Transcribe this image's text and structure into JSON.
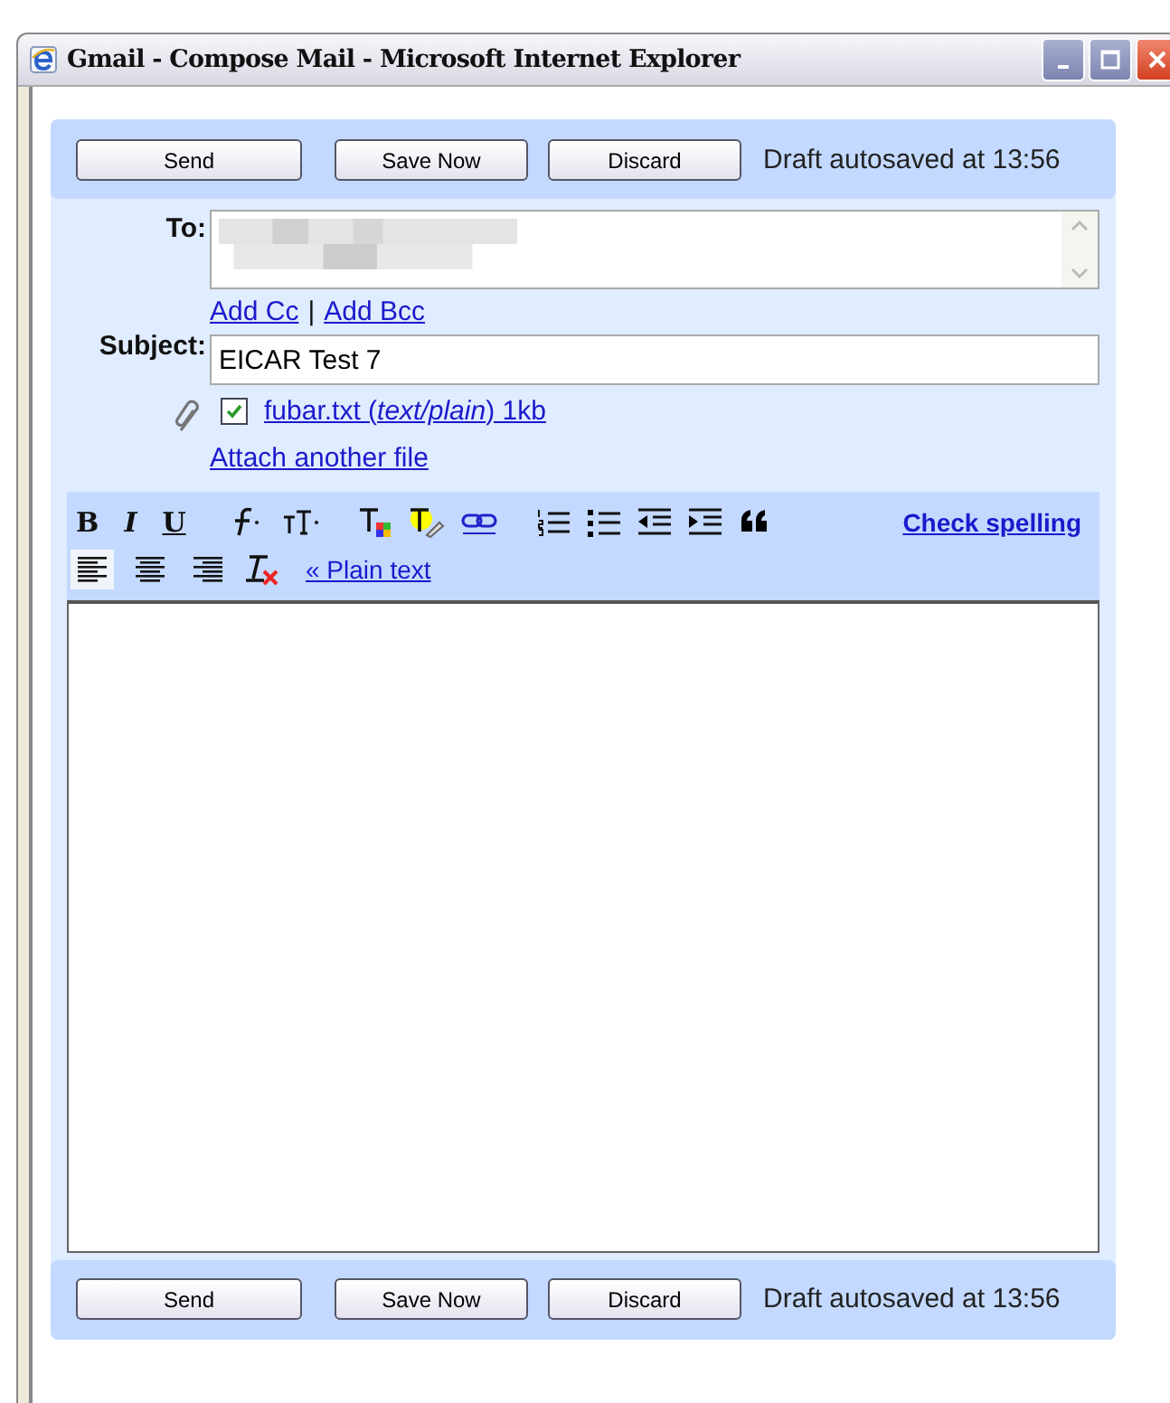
{
  "window": {
    "title": "Gmail - Compose Mail - Microsoft Internet Explorer"
  },
  "top_actions": {
    "buttons": [
      "Send",
      "Save Now",
      "Discard"
    ],
    "status": "Draft autosaved at 13:56"
  },
  "to": {
    "label": "To:"
  },
  "cc_links": [
    "Add Cc",
    "Add Bcc"
  ],
  "cc_separator": "|",
  "subject": {
    "label": "Subject:",
    "value": "EICAR Test 7"
  },
  "attachment": {
    "checked": true,
    "file": "fubar.txt (*text/plain*) 1kb"
  },
  "attach_another": "Attach another file",
  "format_chars": [
    "B",
    "I",
    "U"
  ],
  "align_buttons": [
    {
      "selected": true
    },
    {
      "selected": false
    },
    {
      "selected": false
    }
  ],
  "check_spelling": "Check spelling",
  "plain_text": "« Plain text",
  "bottom_actions": {
    "buttons": [
      "Send",
      "Save Now",
      "Discard"
    ],
    "status": "Draft autosaved at 13:56"
  }
}
